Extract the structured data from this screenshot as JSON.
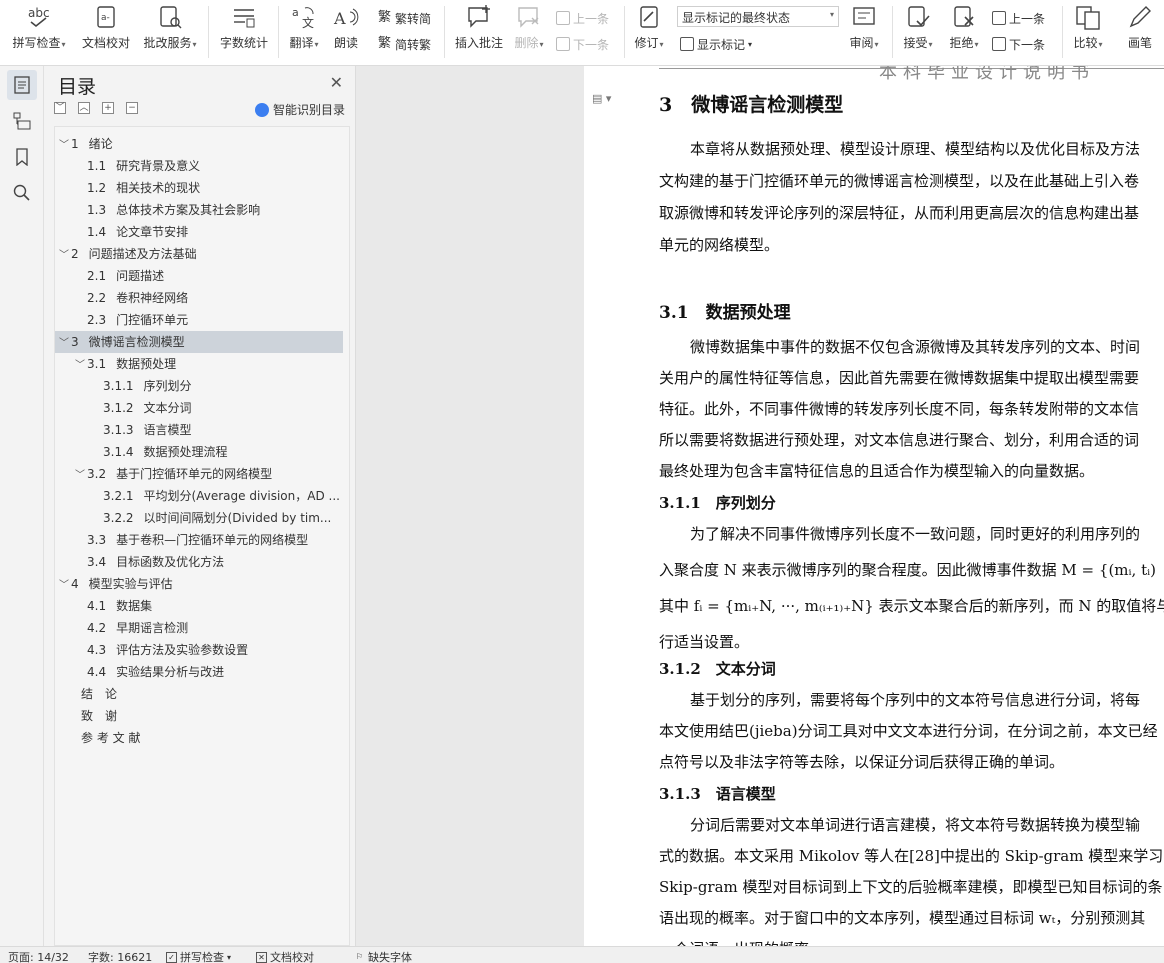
{
  "ribbon": {
    "spell_check": "拼写检查",
    "doc_proofread": "文档校对",
    "annotation_service": "批改服务",
    "word_count": "字数统计",
    "translate": "翻译",
    "read_aloud": "朗读",
    "trad_convert": "繁转简",
    "simp_convert": "简转繁",
    "insert_comment": "插入批注",
    "delete": "删除",
    "prev_item": "上一条",
    "next_item": "下一条",
    "revise": "修订",
    "markup_state": "显示标记的最终状态",
    "show_markup": "显示标记",
    "review": "审阅",
    "accept": "接受",
    "reject": "拒绝",
    "prev_change": "上一条",
    "next_change": "下一条",
    "compare": "比较",
    "pen": "画笔"
  },
  "toc": {
    "title": "目录",
    "smart_label": "智能识别目录",
    "items": [
      {
        "caret": "﹀",
        "num": "1",
        "text": "绪论"
      },
      {
        "caret": "",
        "num": "1.1",
        "text": "研究背景及意义"
      },
      {
        "caret": "",
        "num": "1.2",
        "text": "相关技术的现状"
      },
      {
        "caret": "",
        "num": "1.3",
        "text": "总体技术方案及其社会影响"
      },
      {
        "caret": "",
        "num": "1.4",
        "text": "论文章节安排"
      },
      {
        "caret": "﹀",
        "num": "2",
        "text": "问题描述及方法基础"
      },
      {
        "caret": "",
        "num": "2.1",
        "text": "问题描述"
      },
      {
        "caret": "",
        "num": "2.2",
        "text": "卷积神经网络"
      },
      {
        "caret": "",
        "num": "2.3",
        "text": "门控循环单元"
      },
      {
        "caret": "﹀",
        "num": "3",
        "text": "微博谣言检测模型"
      },
      {
        "caret": "﹀",
        "num": "3.1",
        "text": "数据预处理"
      },
      {
        "caret": "",
        "num": "3.1.1",
        "text": "序列划分"
      },
      {
        "caret": "",
        "num": "3.1.2",
        "text": "文本分词"
      },
      {
        "caret": "",
        "num": "3.1.3",
        "text": "语言模型"
      },
      {
        "caret": "",
        "num": "3.1.4",
        "text": "数据预处理流程"
      },
      {
        "caret": "﹀",
        "num": "3.2",
        "text": "基于门控循环单元的网络模型"
      },
      {
        "caret": "",
        "num": "3.2.1",
        "text": "平均划分(Average division，AD ..."
      },
      {
        "caret": "",
        "num": "3.2.2",
        "text": "以时间间隔划分(Divided by tim..."
      },
      {
        "caret": "",
        "num": "3.3",
        "text": "基于卷积—门控循环单元的网络模型"
      },
      {
        "caret": "",
        "num": "3.4",
        "text": "目标函数及优化方法"
      },
      {
        "caret": "﹀",
        "num": "4",
        "text": "模型实验与评估"
      },
      {
        "caret": "",
        "num": "4.1",
        "text": "数据集"
      },
      {
        "caret": "",
        "num": "4.2",
        "text": "早期谣言检测"
      },
      {
        "caret": "",
        "num": "4.3",
        "text": "评估方法及实验参数设置"
      },
      {
        "caret": "",
        "num": "4.4",
        "text": "实验结果分析与改进"
      },
      {
        "caret": "",
        "num": "",
        "text": "结　论"
      },
      {
        "caret": "",
        "num": "",
        "text": "致　谢"
      },
      {
        "caret": "",
        "num": "",
        "text": "参 考 文 献"
      }
    ]
  },
  "document": {
    "header": "本科毕业设计说明书",
    "chapter_title": "3　微博谣言检测模型",
    "intro": [
      "本章将从数据预处理、模型设计原理、模型结构以及优化目标及方法",
      "文构建的基于门控循环单元的微博谣言检测模型，以及在此基础上引入卷",
      "取源微博和转发评论序列的深层特征，从而利用更高层次的信息构建出基",
      "单元的网络模型。"
    ],
    "sec_3_1": "3.1　数据预处理",
    "sec_3_1_paras": [
      "微博数据集中事件的数据不仅包含源微博及其转发序列的文本、时间",
      "关用户的属性特征等信息，因此首先需要在微博数据集中提取出模型需要",
      "特征。此外，不同事件微博的转发序列长度不同，每条转发附带的文本信",
      "所以需要将数据进行预处理，对文本信息进行聚合、划分，利用合适的词",
      "最终处理为包含丰富特征信息的且适合作为模型输入的向量数据。"
    ],
    "sec_3_1_1": "3.1.1　序列划分",
    "sec_3_1_1_paras": [
      "为了解决不同事件微博序列长度不一致问题，同时更好的利用序列的",
      "入聚合度 N 来表示微博序列的聚合程度。因此微博事件数据 M = {(mᵢ, tᵢ)",
      "其中 fᵢ = {mᵢ₊N, ···, m₍ᵢ₊₁₎₊N} 表示文本聚合后的新序列，而 N 的取值将与",
      "行适当设置。"
    ],
    "sec_3_1_2": "3.1.2　文本分词",
    "sec_3_1_2_paras": [
      "基于划分的序列，需要将每个序列中的文本符号信息进行分词，将每",
      "本文使用结巴(jieba)分词工具对中文文本进行分词，在分词之前，本文已经",
      "点符号以及非法字符等去除，以保证分词后获得正确的单词。"
    ],
    "sec_3_1_3": "3.1.3　语言模型",
    "sec_3_1_3_paras": [
      "分词后需要对文本单词进行语言建模，将文本符号数据转换为模型输",
      "式的数据。本文采用 Mikolov 等人在[28]中提出的 Skip-gram 模型来学习",
      "Skip-gram 模型对目标词到上下文的后验概率建模，即模型已知目标词的条",
      "语出现的概率。对于窗口中的文本序列，模型通过目标词 wₜ，分别预测其",
      "一个词语，出现的概率"
    ]
  },
  "status": {
    "page": "页面: 14/32",
    "words": "字数: 16621",
    "spell": "拼写检查",
    "proofread": "文档校对",
    "missing_font": "缺失字体"
  }
}
